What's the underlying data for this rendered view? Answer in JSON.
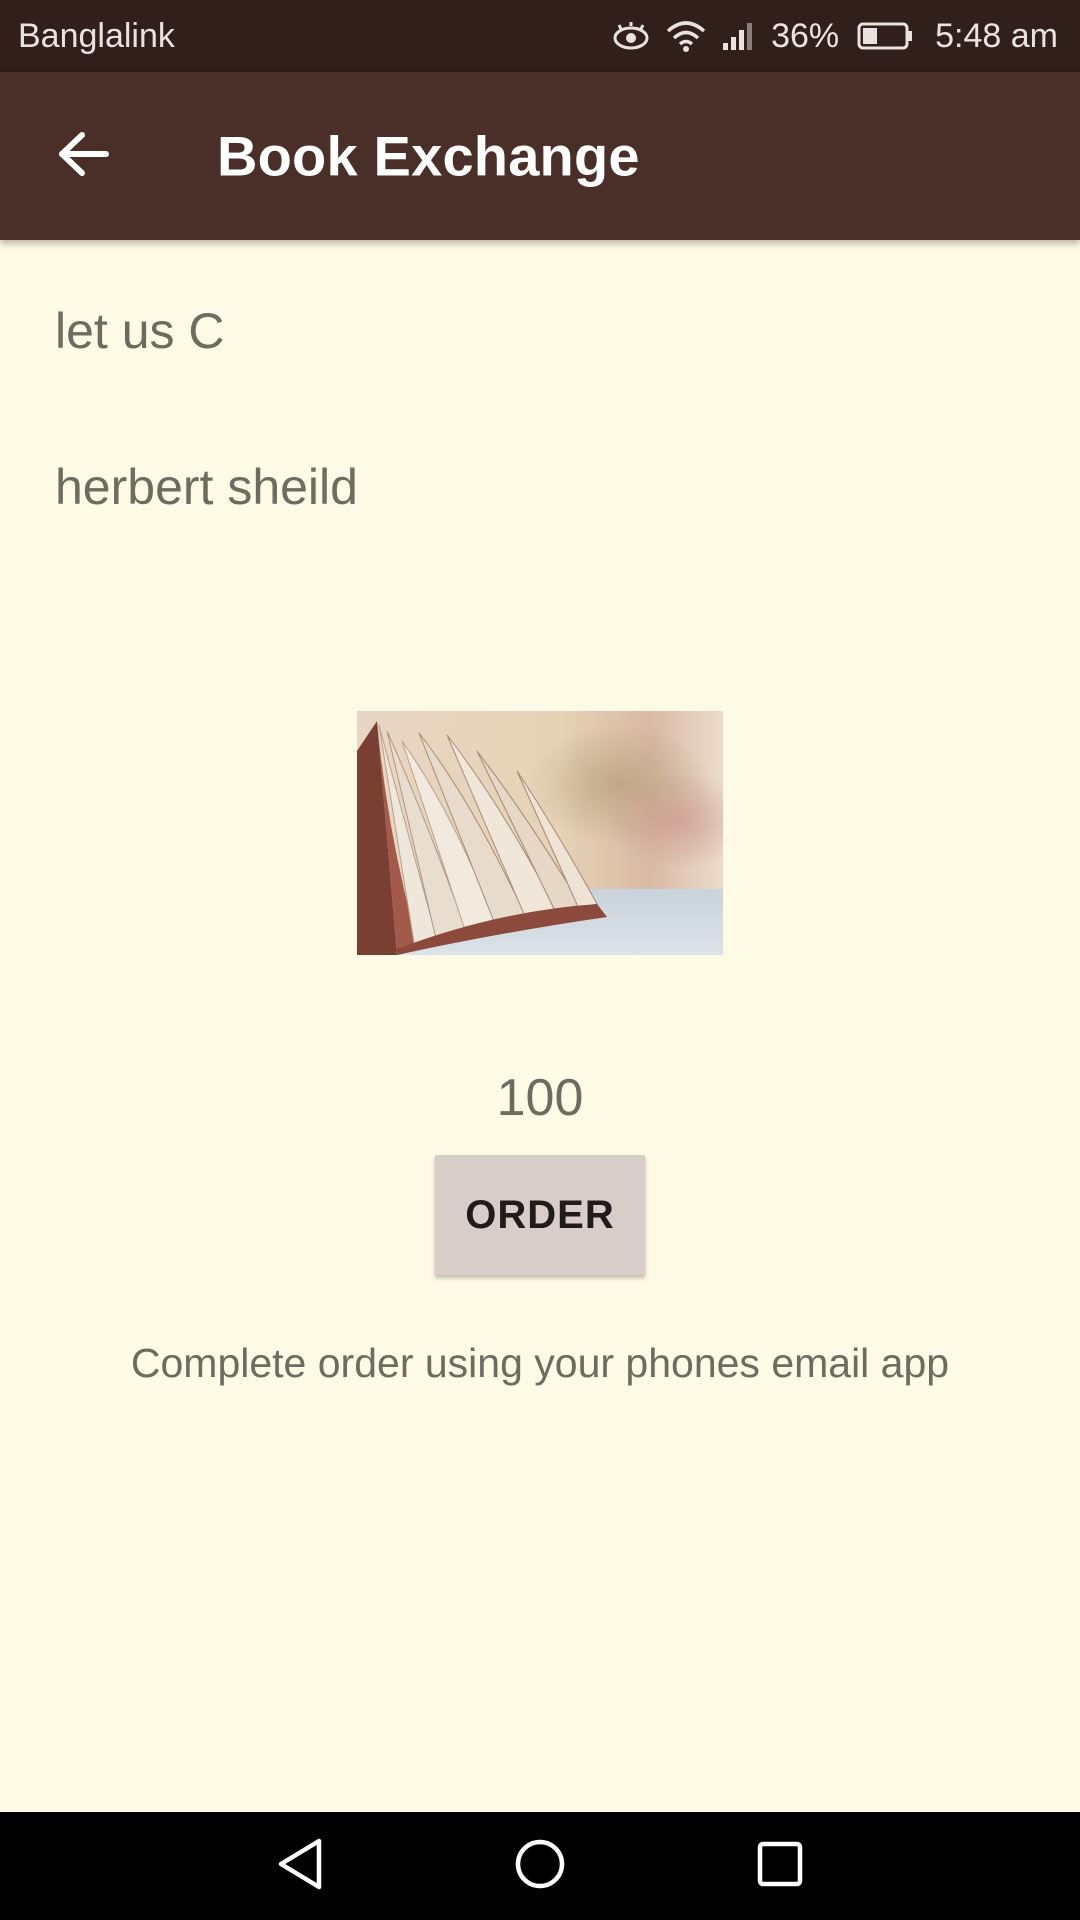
{
  "status_bar": {
    "carrier": "Banglalink",
    "battery_percent": "36%",
    "time": "5:48 am",
    "icons": [
      "eye-comfort-icon",
      "wifi-icon",
      "cell-signal-icon",
      "battery-icon"
    ],
    "battery_level": 0.36
  },
  "app_bar": {
    "title": "Book Exchange",
    "back_icon": "arrow-left-icon"
  },
  "book": {
    "title": "let us C",
    "author": "herbert sheild",
    "price": "100",
    "image_icon": "open-book-photo"
  },
  "actions": {
    "order_label": "ORDER",
    "hint": "Complete order using your phones email app"
  },
  "nav_bar": {
    "icons": [
      "back-triangle-icon",
      "home-circle-icon",
      "recents-square-icon"
    ]
  },
  "colors": {
    "status_bar_bg": "#311f1c",
    "app_bar_bg": "#4a2e28",
    "page_bg": "#fdfbe6",
    "text_secondary": "#6e6b60",
    "button_bg": "#d8cdc9"
  }
}
